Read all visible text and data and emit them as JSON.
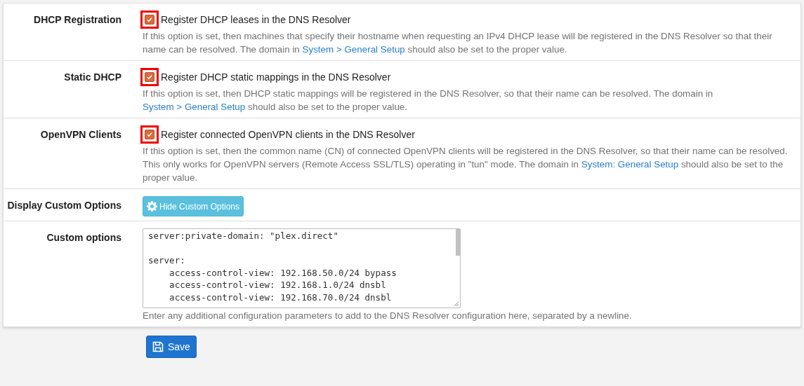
{
  "rows": [
    {
      "kind": "checkbox",
      "label": "DHCP Registration",
      "checked": true,
      "highlighted": true,
      "option": "Register DHCP leases in the DNS Resolver",
      "help": [
        {
          "text": "If this option is set, then machines that specify their hostname when requesting an IPv4 DHCP lease will be registered in the DNS Resolver so that their name can be resolved. The domain in "
        },
        {
          "link": "System > General Setup"
        },
        {
          "text": " should also be set to the proper value."
        }
      ]
    },
    {
      "kind": "checkbox",
      "label": "Static DHCP",
      "checked": true,
      "highlighted": true,
      "option": "Register DHCP static mappings in the DNS Resolver",
      "help": [
        {
          "text": "If this option is set, then DHCP static mappings will be registered in the DNS Resolver, so that their name can be resolved. The domain in "
        },
        {
          "link": "System > General Setup"
        },
        {
          "text": " should also be set to the proper value."
        }
      ]
    },
    {
      "kind": "checkbox",
      "label": "OpenVPN Clients",
      "checked": true,
      "highlighted": true,
      "option": "Register connected OpenVPN clients in the DNS Resolver",
      "help": [
        {
          "text": "If this option is set, then the common name (CN) of connected OpenVPN clients will be registered in the DNS Resolver, so that their name can be resolved. This only works for OpenVPN servers (Remote Access SSL/TLS) operating in \"tun\" mode. The domain in "
        },
        {
          "link": "System: General Setup"
        },
        {
          "text": " should also be set to the proper value."
        }
      ]
    },
    {
      "kind": "button",
      "label": "Display Custom Options",
      "button": "Hide Custom Options"
    },
    {
      "kind": "textarea",
      "label": "Custom options",
      "value": "server:private-domain: \"plex.direct\"\n\nserver:\n    access-control-view: 192.168.50.0/24 bypass\n    access-control-view: 192.168.1.0/24 dnsbl\n    access-control-view: 192.168.70.0/24 dnsbl",
      "help": [
        {
          "text": "Enter any additional configuration parameters to add to the DNS Resolver configuration here, separated by a newline."
        }
      ]
    }
  ],
  "save_button": "Save"
}
